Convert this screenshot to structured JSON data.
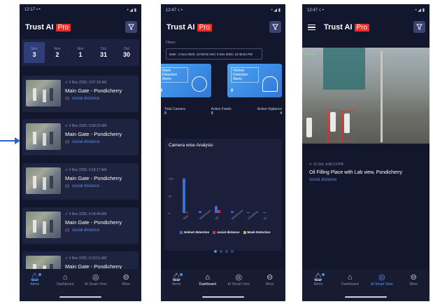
{
  "app": {
    "title": "Trust AI",
    "badge": "Pro"
  },
  "colors": {
    "background": "#13172d",
    "accent": "#4a94f2",
    "badge": "#e8302a",
    "card": "#3d8fe8"
  },
  "screens": [
    {
      "status_time": "12:17",
      "dates": [
        {
          "month": "Nov",
          "day": "3",
          "selected": true
        },
        {
          "month": "Nov",
          "day": "2"
        },
        {
          "month": "Nov",
          "day": "1"
        },
        {
          "month": "Oct",
          "day": "31"
        },
        {
          "month": "Oct",
          "day": "30"
        }
      ],
      "alerts": [
        {
          "time": "3 Nov 2020, 3:57:18 AM",
          "location": "Main Gate - Pondicherry",
          "type": "social distance"
        },
        {
          "time": "3 Nov 2020, 5:58:23 AM",
          "location": "Main Gate - Pondicherry",
          "type": "social distance"
        },
        {
          "time": "3 Nov 2020, 6:18:17 AM",
          "location": "Main Gate - Pondicherry",
          "type": "social distance"
        },
        {
          "time": "3 Nov 2020, 6:18:49 AM",
          "location": "Main Gate - Pondicherry",
          "type": "social distance"
        },
        {
          "time": "3 Nov 2020, 6:23:51 AM",
          "location": "Main Gate - Pondicherry",
          "type": ""
        }
      ]
    },
    {
      "status_time": "12:47",
      "filters_label": "Filters",
      "date_range": "Date : 3 Nov 2020, 12:00:02 AM | 3 Nov 2020, 12:46:54 PM",
      "cards": [
        {
          "label": "Mask Detection Alerts",
          "value": "9",
          "icon": "mask-icon"
        },
        {
          "label": "Helmet Detection Alerts",
          "value": "0",
          "icon": "helmet-icon"
        }
      ],
      "stats": [
        {
          "label": "Total Camera",
          "value": "9"
        },
        {
          "label": "Active Feeds",
          "value": "9"
        },
        {
          "label": "Active Vigilance",
          "value": "4"
        }
      ],
      "panel_title": "Camera wise Analysis"
    },
    {
      "status_time": "12:47",
      "time": "12 Oct, 4:08:13 PM",
      "location": "Oil Filling Place with Lab view, Pondicherry",
      "type": "social distance"
    }
  ],
  "nav": [
    {
      "label": "Alerts",
      "icon": "bell-icon"
    },
    {
      "label": "Dashboard",
      "icon": "home-icon"
    },
    {
      "label": "AI Smart View",
      "icon": "eye-icon"
    },
    {
      "label": "More",
      "icon": "more-icon"
    }
  ],
  "chart_data": {
    "type": "bar",
    "categories": [
      "Main",
      "Warehouse",
      "Oil",
      "Warehouse",
      "Unloading",
      "OL"
    ],
    "series": [
      {
        "name": "Helmet detection",
        "color": "#3b6fd8",
        "values": [
          100,
          5,
          20,
          5,
          2,
          2
        ]
      },
      {
        "name": "social distance",
        "color": "#e0342e",
        "values": [
          2,
          0,
          8,
          0,
          0,
          0
        ]
      },
      {
        "name": "Mask Detection",
        "color": "#9ecb2e",
        "values": [
          0,
          0,
          0,
          0,
          0,
          0
        ]
      }
    ],
    "yticks": [
      "100",
      "50",
      "0"
    ],
    "ylim": [
      0,
      150
    ]
  }
}
